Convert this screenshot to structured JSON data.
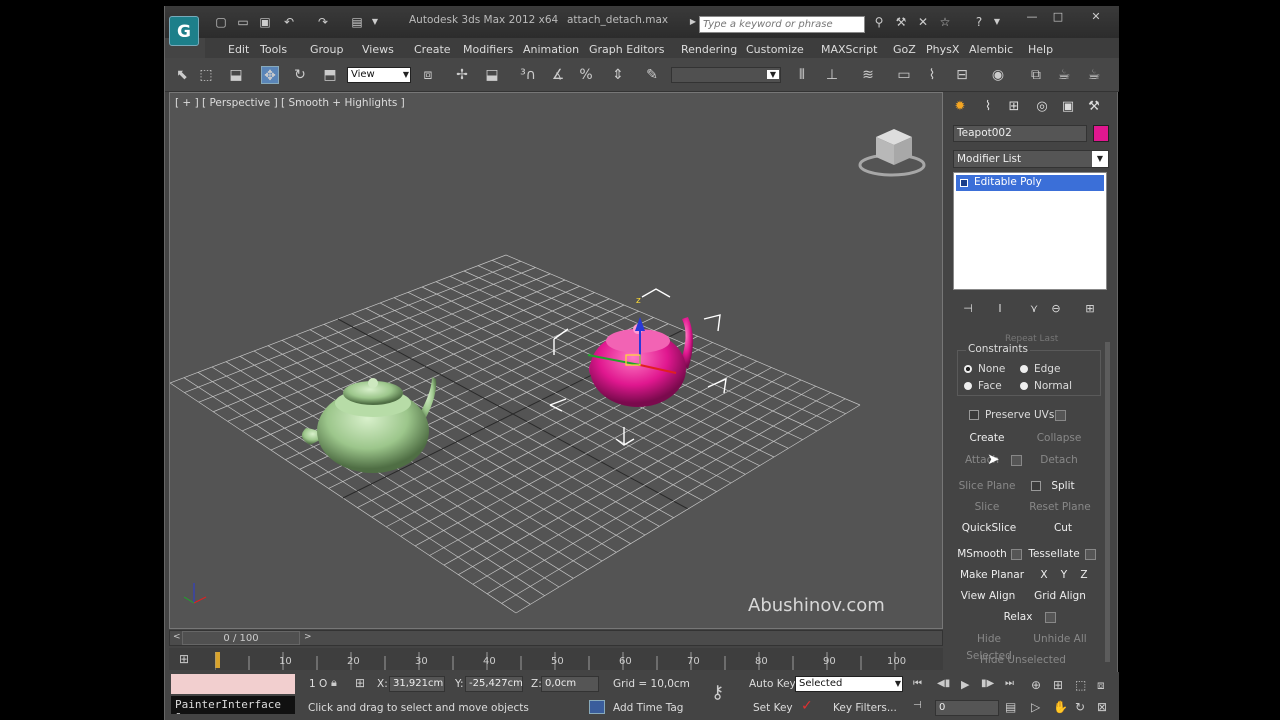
{
  "titlebar": {
    "app_title": "Autodesk 3ds Max  2012 x64",
    "file_title": "attach_detach.max",
    "search_placeholder": "Type a keyword or phrase",
    "logo": "G"
  },
  "menu": [
    "Edit",
    "Tools",
    "Group",
    "Views",
    "Create",
    "Modifiers",
    "Animation",
    "Graph Editors",
    "Rendering",
    "Customize",
    "MAXScript",
    "GoZ",
    "PhysX",
    "Alembic",
    "Help"
  ],
  "toolbar": {
    "ref_coord": "View"
  },
  "viewport": {
    "label": "[ + ] [ Perspective ] [ Smooth + Highlights ]",
    "watermark": "Abushinov.com",
    "teapot_green_color": "#9cc68b",
    "teapot_pink_color": "#e0178f",
    "gizmo_z_label": "z"
  },
  "command_panel": {
    "object_name": "Teapot002",
    "object_color": "#e0178f",
    "modifier_list": "Modifier List",
    "stack_item": "Editable Poly",
    "rollout_header": "Repeat Last",
    "constraints": {
      "title": "Constraints",
      "options": [
        "None",
        "Edge",
        "Face",
        "Normal"
      ],
      "selected": "None"
    },
    "preserve_uvs": "Preserve UVs",
    "buttons": {
      "create": "Create",
      "collapse": "Collapse",
      "attach": "Attach",
      "detach": "Detach",
      "slice_plane": "Slice Plane",
      "split": "Split",
      "slice": "Slice",
      "reset_plane": "Reset Plane",
      "quickslice": "QuickSlice",
      "cut": "Cut",
      "msmooth": "MSmooth",
      "tessellate": "Tessellate",
      "make_planar": "Make Planar",
      "x": "X",
      "y": "Y",
      "z": "Z",
      "view_align": "View Align",
      "grid_align": "Grid Align",
      "relax": "Relax",
      "hide_selected": "Hide Selected",
      "unhide_all": "Unhide All",
      "hide_unselected": "Hide Unselected"
    }
  },
  "timeline": {
    "slider": "0 / 100",
    "ticks": [
      "10",
      "20",
      "30",
      "40",
      "50",
      "60",
      "70",
      "80",
      "90",
      "100"
    ]
  },
  "status": {
    "maxscript_listener": "PainterInterface §",
    "selection_count": "1 O",
    "x_label": "X:",
    "x_value": "31,921cm",
    "y_label": "Y:",
    "y_value": "-25,427cm",
    "z_label": "Z:",
    "z_value": "0,0cm",
    "grid": "Grid = 10,0cm",
    "prompt": "Click and drag to select and move objects",
    "add_time_tag": "Add Time Tag",
    "auto_key": "Auto Key",
    "set_key": "Set Key",
    "key_mode": "Selected",
    "key_filters": "Key Filters...",
    "frame": "0"
  }
}
